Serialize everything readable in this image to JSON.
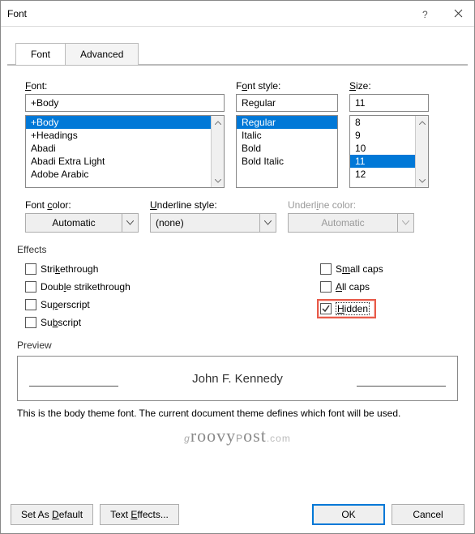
{
  "title": "Font",
  "tabs": {
    "font": "Font",
    "advanced": "Advanced"
  },
  "labels": {
    "font": "Font:",
    "fontStyle": "Font style:",
    "size": "Size:",
    "fontColor": "Font color:",
    "underlineStyle": "Underline style:",
    "underlineColor": "Underline color:",
    "effects": "Effects",
    "preview": "Preview"
  },
  "font": {
    "value": "+Body",
    "items": [
      "+Body",
      "+Headings",
      "Abadi",
      "Abadi Extra Light",
      "Adobe Arabic"
    ]
  },
  "fontStyle": {
    "value": "Regular",
    "items": [
      "Regular",
      "Italic",
      "Bold",
      "Bold Italic"
    ]
  },
  "size": {
    "value": "11",
    "items": [
      "8",
      "9",
      "10",
      "11",
      "12"
    ]
  },
  "fontColor": "Automatic",
  "underlineStyle": "(none)",
  "underlineColor": "Automatic",
  "effects": {
    "strikethrough": "Strikethrough",
    "doubleStrike": "Double strikethrough",
    "superscript": "Superscript",
    "subscript": "Subscript",
    "smallCaps": "Small caps",
    "allCaps": "All caps",
    "hidden": "Hidden"
  },
  "previewText": "John F. Kennedy",
  "description": "This is the body theme font. The current document theme defines which font will be used.",
  "watermark": "groovyPost.com",
  "buttons": {
    "setDefault": "Set As Default",
    "textEffects": "Text Effects...",
    "ok": "OK",
    "cancel": "Cancel"
  }
}
